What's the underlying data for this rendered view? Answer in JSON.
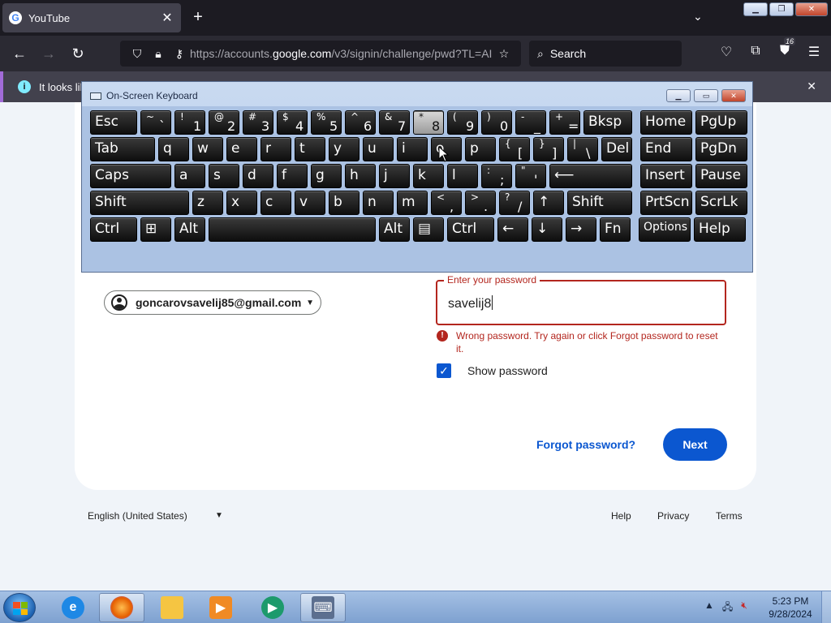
{
  "browser": {
    "tab_title": "YouTube",
    "tab_icon_letter": "G",
    "url": "https://accounts.",
    "url_domain": "google.com",
    "url_path": "/v3/signin/challenge/pwd?TL=AI",
    "search_placeholder": "Search",
    "extension_badge": "16",
    "notification_text": "It looks like"
  },
  "osk": {
    "title": "On-Screen Keyboard",
    "rows": [
      [
        {
          "id": "esc",
          "label": "Esc",
          "w": 58
        },
        {
          "id": "tilde",
          "sub": "~",
          "main": "`",
          "w": 38
        },
        {
          "id": "1",
          "sub": "!",
          "main": "1",
          "w": 38
        },
        {
          "id": "2",
          "sub": "@",
          "main": "2",
          "w": 38
        },
        {
          "id": "3",
          "sub": "#",
          "main": "3",
          "w": 38
        },
        {
          "id": "4",
          "sub": "$",
          "main": "4",
          "w": 38
        },
        {
          "id": "5",
          "sub": "%",
          "main": "5",
          "w": 38
        },
        {
          "id": "6",
          "sub": "^",
          "main": "6",
          "w": 38
        },
        {
          "id": "7",
          "sub": "&",
          "main": "7",
          "w": 38
        },
        {
          "id": "8",
          "sub": "*",
          "main": "8",
          "w": 38,
          "pressed": true
        },
        {
          "id": "9",
          "sub": "(",
          "main": "9",
          "w": 38
        },
        {
          "id": "0",
          "sub": ")",
          "main": "0",
          "w": 38
        },
        {
          "id": "minus",
          "sub": "-",
          "main": "_",
          "w": 38
        },
        {
          "id": "equals",
          "sub": "+",
          "main": "=",
          "w": 38
        },
        {
          "id": "bksp",
          "label": "Bksp",
          "w": 60
        },
        {
          "id": "home",
          "label": "Home",
          "w": 64,
          "gap": 6
        },
        {
          "id": "pgup",
          "label": "PgUp",
          "w": 64
        }
      ],
      [
        {
          "id": "tab",
          "label": "Tab",
          "w": 80
        },
        {
          "id": "q",
          "label": "q",
          "w": 38
        },
        {
          "id": "w",
          "label": "w",
          "w": 38
        },
        {
          "id": "e",
          "label": "e",
          "w": 38
        },
        {
          "id": "r",
          "label": "r",
          "w": 38
        },
        {
          "id": "t",
          "label": "t",
          "w": 38
        },
        {
          "id": "y",
          "label": "y",
          "w": 38
        },
        {
          "id": "u",
          "label": "u",
          "w": 38
        },
        {
          "id": "i",
          "label": "i",
          "w": 38
        },
        {
          "id": "o",
          "label": "o",
          "w": 38
        },
        {
          "id": "p",
          "label": "p",
          "w": 38
        },
        {
          "id": "lbracket",
          "sub": "{",
          "main": "[",
          "w": 38
        },
        {
          "id": "rbracket",
          "sub": "}",
          "main": "]",
          "w": 38
        },
        {
          "id": "backslash",
          "sub": "|",
          "main": "\\",
          "w": 38
        },
        {
          "id": "del",
          "label": "Del",
          "w": 38
        },
        {
          "id": "end",
          "label": "End",
          "w": 64,
          "gap": 6
        },
        {
          "id": "pgdn",
          "label": "PgDn",
          "w": 64
        }
      ],
      [
        {
          "id": "caps",
          "label": "Caps",
          "w": 100
        },
        {
          "id": "a",
          "label": "a",
          "w": 38
        },
        {
          "id": "s",
          "label": "s",
          "w": 38
        },
        {
          "id": "d",
          "label": "d",
          "w": 38
        },
        {
          "id": "f",
          "label": "f",
          "w": 38
        },
        {
          "id": "g",
          "label": "g",
          "w": 38
        },
        {
          "id": "h",
          "label": "h",
          "w": 38
        },
        {
          "id": "j",
          "label": "j",
          "w": 38
        },
        {
          "id": "k",
          "label": "k",
          "w": 38
        },
        {
          "id": "l",
          "label": "l",
          "w": 38
        },
        {
          "id": "semicolon",
          "sub": ":",
          "main": ";",
          "w": 38
        },
        {
          "id": "quote",
          "sub": "\"",
          "main": "'",
          "w": 38
        },
        {
          "id": "enter",
          "label": "⟵",
          "w": 102
        },
        {
          "id": "insert",
          "label": "Insert",
          "w": 64,
          "gap": 6
        },
        {
          "id": "pause",
          "label": "Pause",
          "w": 64
        }
      ],
      [
        {
          "id": "lshift",
          "label": "Shift",
          "w": 122
        },
        {
          "id": "z",
          "label": "z",
          "w": 38
        },
        {
          "id": "x",
          "label": "x",
          "w": 38
        },
        {
          "id": "c",
          "label": "c",
          "w": 38
        },
        {
          "id": "v",
          "label": "v",
          "w": 38
        },
        {
          "id": "b",
          "label": "b",
          "w": 38
        },
        {
          "id": "n",
          "label": "n",
          "w": 38
        },
        {
          "id": "m",
          "label": "m",
          "w": 38
        },
        {
          "id": "comma",
          "sub": "<",
          "main": ",",
          "w": 38
        },
        {
          "id": "period",
          "sub": ">",
          "main": ".",
          "w": 38
        },
        {
          "id": "slash",
          "sub": "?",
          "main": "/",
          "w": 38
        },
        {
          "id": "up",
          "label": "↑",
          "w": 38
        },
        {
          "id": "rshift",
          "label": "Shift",
          "w": 80
        },
        {
          "id": "prtscn",
          "label": "PrtScn",
          "w": 64,
          "gap": 6
        },
        {
          "id": "scrlk",
          "label": "ScrLk",
          "w": 64
        }
      ],
      [
        {
          "id": "lctrl",
          "label": "Ctrl",
          "w": 58
        },
        {
          "id": "win",
          "label": "⊞",
          "w": 38
        },
        {
          "id": "lalt",
          "label": "Alt",
          "w": 38
        },
        {
          "id": "space",
          "label": "",
          "w": 206
        },
        {
          "id": "ralt",
          "label": "Alt",
          "w": 38
        },
        {
          "id": "menu",
          "label": "▤",
          "w": 38
        },
        {
          "id": "rctrl",
          "label": "Ctrl",
          "w": 58
        },
        {
          "id": "left",
          "label": "←",
          "w": 38
        },
        {
          "id": "down",
          "label": "↓",
          "w": 38
        },
        {
          "id": "right",
          "label": "→",
          "w": 38
        },
        {
          "id": "fn",
          "label": "Fn",
          "w": 38
        },
        {
          "id": "options",
          "label": "Options",
          "w": 64,
          "gap": 6
        },
        {
          "id": "help",
          "label": "Help",
          "w": 64
        }
      ]
    ]
  },
  "signin": {
    "email": "goncarovsavelij85@gmail.com",
    "password_label": "Enter your password",
    "password_value": "savelij8",
    "error_text": "Wrong password. Try again or click Forgot password to reset it.",
    "show_password_label": "Show password",
    "forgot_label": "Forgot password?",
    "next_label": "Next"
  },
  "footer": {
    "language": "English (United States)",
    "help": "Help",
    "privacy": "Privacy",
    "terms": "Terms"
  },
  "taskbar": {
    "time": "5:23 PM",
    "date": "9/28/2024"
  },
  "colors": {
    "accent": "#0b57d0",
    "error": "#b3261e"
  }
}
